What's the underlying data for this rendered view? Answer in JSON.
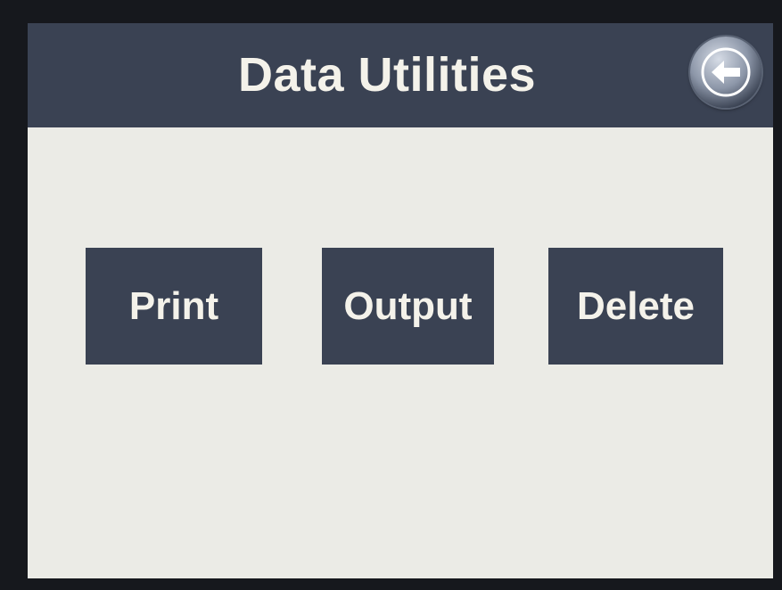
{
  "header": {
    "title": "Data Utilities",
    "back_icon": "arrow-left-icon"
  },
  "buttons": {
    "print_label": "Print",
    "output_label": "Output",
    "delete_label": "Delete"
  },
  "colors": {
    "header_bg": "#3a4253",
    "button_bg": "#3a4253",
    "screen_bg": "#ebebe6",
    "text": "#f4f2ea"
  }
}
